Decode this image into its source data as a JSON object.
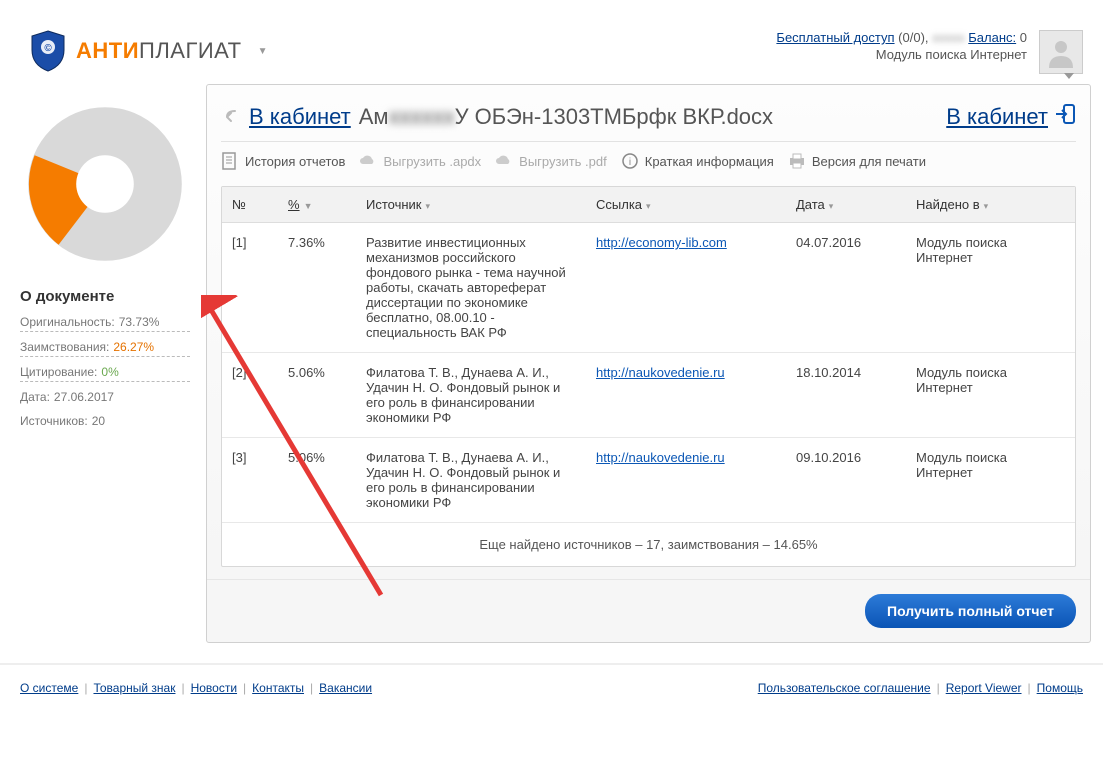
{
  "header": {
    "logo_anti": "АНТИ",
    "logo_plag": "ПЛАГИАТ",
    "free_access": "Бесплатный доступ",
    "free_access_count": "(0/0),",
    "balance_label": "Баланс:",
    "balance_value": "0",
    "module": "Модуль поиска Интернет"
  },
  "sidebar": {
    "title": "О документе",
    "originality_label": "Оригинальность:",
    "originality_value": "73.73%",
    "borrow_label": "Заимствования:",
    "borrow_value": "26.27%",
    "citation_label": "Цитирование:",
    "citation_value": "0%",
    "date_label": "Дата:",
    "date_value": "27.06.2017",
    "sources_label": "Источников:",
    "sources_value": "20"
  },
  "chart_data": {
    "type": "pie",
    "title": "",
    "series": [
      {
        "name": "Оригинальность",
        "value": 73.73,
        "color": "#d9d9d9"
      },
      {
        "name": "Заимствования",
        "value": 26.27,
        "color": "#f57c00"
      },
      {
        "name": "Цитирование",
        "value": 0,
        "color": "#6aa84f"
      }
    ]
  },
  "content": {
    "back_label": "В кабинет",
    "doc_left": "Ам",
    "doc_right": "У ОБЭн-1303ТМБрфк ВКР.docx",
    "right_link": "В кабинет",
    "toolbar": {
      "history": "История отчетов",
      "export_apdx": "Выгрузить .apdx",
      "export_pdf": "Выгрузить .pdf",
      "short_info": "Краткая информация",
      "print": "Версия для печати"
    },
    "table": {
      "headers": {
        "no": "№",
        "pct": "%",
        "source": "Источник",
        "link": "Ссылка",
        "date": "Дата",
        "found_in": "Найдено в"
      },
      "rows": [
        {
          "no": "[1]",
          "pct": "7.36%",
          "source": "Развитие инвестиционных механизмов российского фондового рынка - тема научной работы, скачать автореферат диссертации по экономике бесплатно, 08.00.10 - специальность ВАК РФ",
          "link": "http://economy-lib.com",
          "date": "04.07.2016",
          "found": "Модуль поиска Интернет"
        },
        {
          "no": "[2]",
          "pct": "5.06%",
          "source": "Филатова Т. В., Дунаева А. И., Удачин Н. О. Фондовый рынок и его роль в финансировании экономики РФ",
          "link": "http://naukovedenie.ru",
          "date": "18.10.2014",
          "found": "Модуль поиска Интернет"
        },
        {
          "no": "[3]",
          "pct": "5.06%",
          "source": "Филатова Т. В., Дунаева А. И., Удачин Н. О. Фондовый рынок и его роль в финансировании экономики РФ",
          "link": "http://naukovedenie.ru",
          "date": "09.10.2016",
          "found": "Модуль поиска Интернет"
        }
      ],
      "more": "Еще найдено источников – 17, заимствования – 14.65%"
    },
    "full_report_btn": "Получить полный отчет"
  },
  "footer": {
    "left": [
      "О системе",
      "Товарный знак",
      "Новости",
      "Контакты",
      "Вакансии"
    ],
    "right": [
      "Пользовательское соглашение",
      "Report Viewer",
      "Помощь"
    ]
  }
}
